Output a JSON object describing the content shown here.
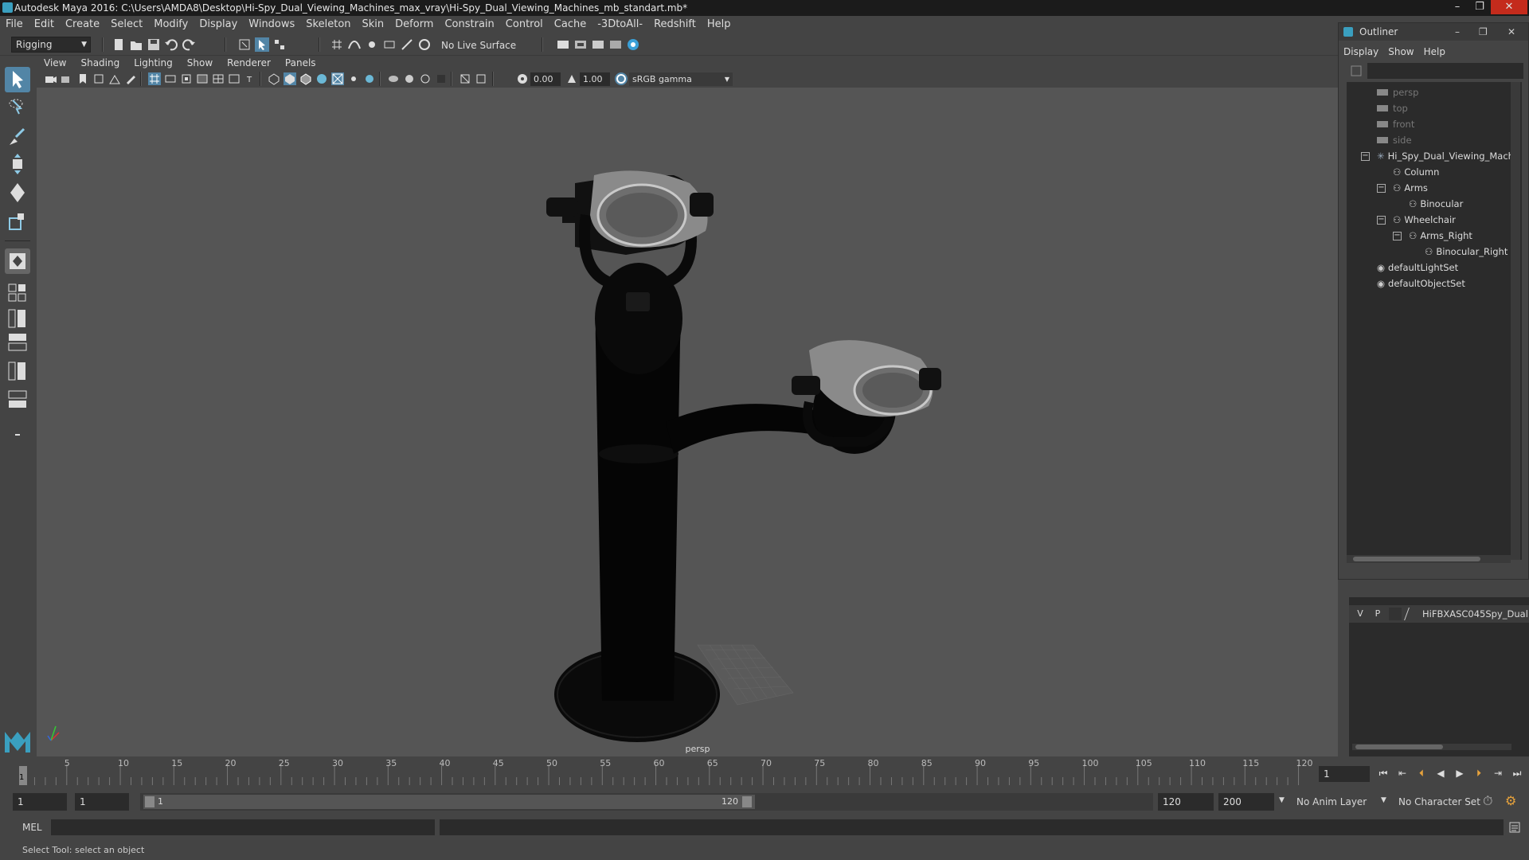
{
  "window": {
    "title": "Autodesk Maya 2016: C:\\Users\\AMDA8\\Desktop\\Hi-Spy_Dual_Viewing_Machines_max_vray\\Hi-Spy_Dual_Viewing_Machines_mb_standart.mb*",
    "controls": [
      "–",
      "❐",
      "✕"
    ]
  },
  "menubar": [
    "File",
    "Edit",
    "Create",
    "Select",
    "Modify",
    "Display",
    "Windows",
    "Skeleton",
    "Skin",
    "Deform",
    "Constrain",
    "Control",
    "Cache",
    "-3DtoAll-",
    "Redshift",
    "Help"
  ],
  "statusline": {
    "menuset": "Rigging",
    "live_surface": "No Live Surface"
  },
  "viewport": {
    "menus": [
      "View",
      "Shading",
      "Lighting",
      "Show",
      "Renderer",
      "Panels"
    ],
    "exposure": "0.00",
    "gamma": "1.00",
    "color_space": "sRGB gamma",
    "camera_label": "persp"
  },
  "outliner": {
    "title": "Outliner",
    "menus": [
      "Display",
      "Show",
      "Help"
    ],
    "items": [
      {
        "label": "persp",
        "icon": "camera-icon",
        "dim": true
      },
      {
        "label": "top",
        "icon": "camera-icon",
        "dim": true
      },
      {
        "label": "front",
        "icon": "camera-icon",
        "dim": true
      },
      {
        "label": "side",
        "icon": "camera-icon",
        "dim": true
      },
      {
        "label": "Hi_Spy_Dual_Viewing_Machi",
        "icon": "joint-icon",
        "expander": "−"
      },
      {
        "label": "Column",
        "icon": "group-icon"
      },
      {
        "label": "Arms",
        "icon": "group-icon",
        "expander": "−"
      },
      {
        "label": "Binocular",
        "icon": "group-icon"
      },
      {
        "label": "Wheelchair",
        "icon": "group-icon",
        "expander": "−"
      },
      {
        "label": "Arms_Right",
        "icon": "group-icon",
        "expander": "−"
      },
      {
        "label": "Binocular_Right",
        "icon": "group-icon"
      },
      {
        "label": "defaultLightSet",
        "icon": "set-icon"
      },
      {
        "label": "defaultObjectSet",
        "icon": "set-icon"
      }
    ]
  },
  "layer_editor": {
    "v": "V",
    "p": "P",
    "layer_name": "HiFBXASC045Spy_Dual"
  },
  "timeslider": {
    "ticks": [
      "5",
      "10",
      "15",
      "20",
      "25",
      "30",
      "35",
      "40",
      "45",
      "50",
      "55",
      "60",
      "65",
      "70",
      "75",
      "80",
      "85",
      "90",
      "95",
      "100",
      "105",
      "110",
      "115",
      "120"
    ],
    "current_tick": "1",
    "current_frame": "1"
  },
  "rangeslider": {
    "start": "1",
    "playback_start": "1",
    "range_start_label": "1",
    "range_end_label": "120",
    "playback_end": "120",
    "end": "200",
    "anim_layer": "No Anim Layer",
    "character_set": "No Character Set"
  },
  "cmdline": {
    "label": "MEL"
  },
  "helpline": {
    "text": "Select Tool: select an object"
  },
  "colors": {
    "ui_bg": "#444444",
    "viewport_bg": "#555555",
    "field_bg": "#2b2b2b",
    "accent": "#5285a6"
  }
}
